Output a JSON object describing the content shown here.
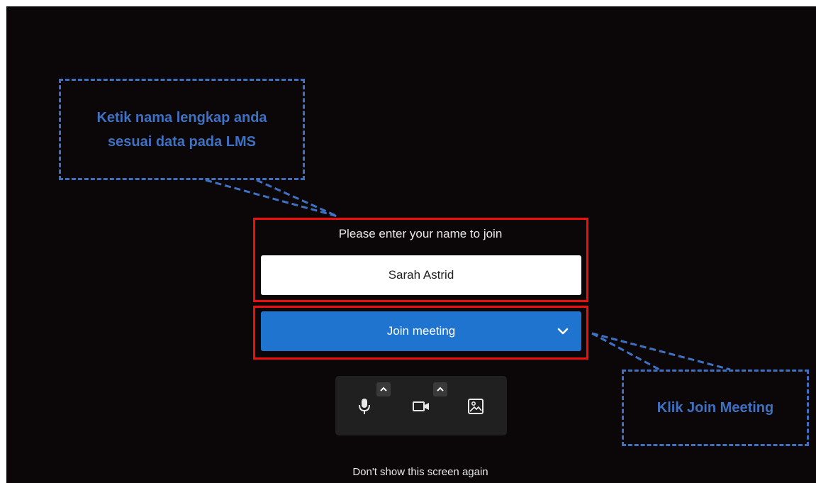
{
  "join_form": {
    "prompt": "Please enter your name to join",
    "name_value": "Sarah Astrid",
    "join_button_label": "Join meeting"
  },
  "toolbar": {
    "icons": [
      "microphone-icon",
      "camera-icon",
      "background-image-icon"
    ]
  },
  "footer": {
    "dont_show_label": "Don't show this screen again"
  },
  "annotations": {
    "name_note": "Ketik nama lengkap anda sesuai data pada LMS",
    "join_note": "Klik Join Meeting"
  },
  "colors": {
    "background": "#0b0708",
    "join_button": "#1f74d0",
    "highlight_box": "#ee0e0e",
    "annotation": "#3e71c2"
  }
}
